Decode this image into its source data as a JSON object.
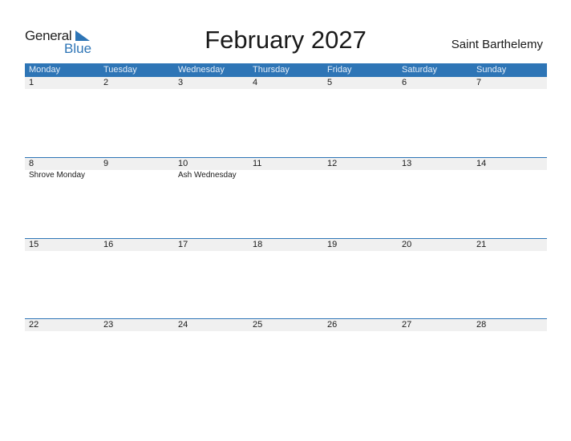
{
  "logo": {
    "general": "General",
    "blue": "Blue"
  },
  "title": "February 2027",
  "region": "Saint Barthelemy",
  "weekdays": [
    "Monday",
    "Tuesday",
    "Wednesday",
    "Thursday",
    "Friday",
    "Saturday",
    "Sunday"
  ],
  "weeks": [
    {
      "days": [
        "1",
        "2",
        "3",
        "4",
        "5",
        "6",
        "7"
      ],
      "events": [
        "",
        "",
        "",
        "",
        "",
        "",
        ""
      ]
    },
    {
      "days": [
        "8",
        "9",
        "10",
        "11",
        "12",
        "13",
        "14"
      ],
      "events": [
        "Shrove Monday",
        "",
        "Ash Wednesday",
        "",
        "",
        "",
        ""
      ]
    },
    {
      "days": [
        "15",
        "16",
        "17",
        "18",
        "19",
        "20",
        "21"
      ],
      "events": [
        "",
        "",
        "",
        "",
        "",
        "",
        ""
      ]
    },
    {
      "days": [
        "22",
        "23",
        "24",
        "25",
        "26",
        "27",
        "28"
      ],
      "events": [
        "",
        "",
        "",
        "",
        "",
        "",
        ""
      ]
    }
  ],
  "colors": {
    "accent": "#2e75b6",
    "day_strip": "#f0f0f0"
  }
}
